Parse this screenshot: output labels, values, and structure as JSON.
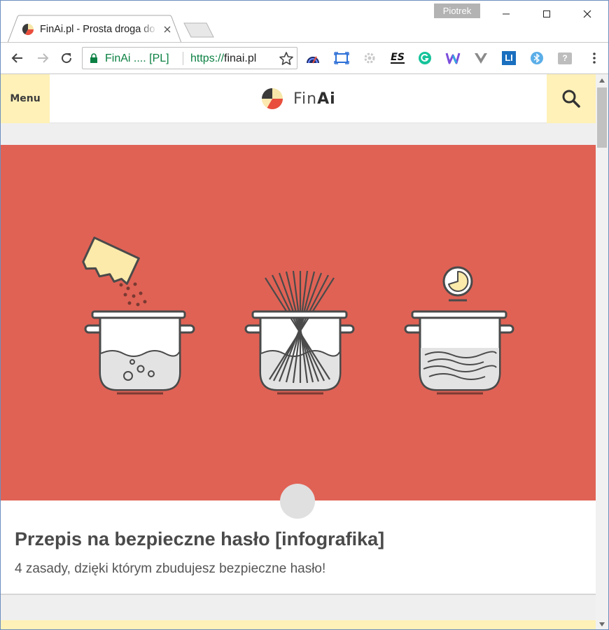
{
  "browser": {
    "profile_name": "Piotrek",
    "tab": {
      "title": "FinAi.pl - Prosta droga do",
      "close_icon": "close-icon"
    },
    "omnibox": {
      "site_name": "FinAi .... [PL]",
      "url_scheme": "https://",
      "url_host": "finai.pl"
    },
    "extensions": [
      "speedtest-icon",
      "screenshot-icon",
      "gear-icon",
      "es-icon",
      "grammarly-icon",
      "wappalyzer-icon",
      "vue-devtools-icon",
      "linkedin-icon",
      "bluetooth-icon",
      "help-icon"
    ],
    "window_controls": [
      "minimize-icon",
      "maximize-icon",
      "close-icon"
    ]
  },
  "site": {
    "menu_label": "Menu",
    "logo": {
      "part1": "Fin",
      "part2": "Ai"
    },
    "colors": {
      "accent_yellow": "#fff1b8",
      "hero_red": "#e06255",
      "logo_red": "#e94e3c"
    }
  },
  "post": {
    "title": "Przepis na bezpieczne hasło [infografika]",
    "excerpt": "4 zasady, dzięki którym zbudujesz bezpieczne hasło!"
  }
}
